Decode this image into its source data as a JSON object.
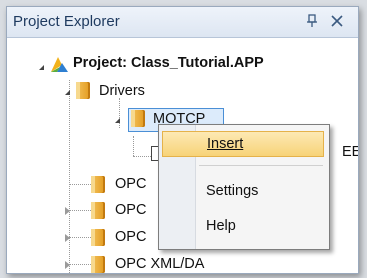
{
  "panel": {
    "title": "Project Explorer",
    "pin_glyph": "Δ",
    "close_glyph": "✕"
  },
  "tree": {
    "project": {
      "label": "Project: Class_Tutorial.APP",
      "icon": "project-app-icon"
    },
    "drivers": {
      "label": "Drivers",
      "icon": "folder-icon"
    },
    "motcp": {
      "label": "MOTCP",
      "icon": "folder-icon"
    },
    "child_suffix": "EET",
    "opc_items": [
      {
        "label": "OPC"
      },
      {
        "label": "OPC"
      },
      {
        "label": "OPC"
      },
      {
        "label": "OPC XML/DA"
      }
    ]
  },
  "context_menu": {
    "items": [
      {
        "label": "Insert",
        "highlighted": true
      },
      {
        "label": "Settings",
        "highlighted": false
      },
      {
        "label": "Help",
        "highlighted": false
      }
    ]
  },
  "colors": {
    "title_text": "#1e3a5f",
    "selection_border": "#4a8fd6",
    "menu_highlight": "#f7d378",
    "folder": "#e39b1f"
  }
}
